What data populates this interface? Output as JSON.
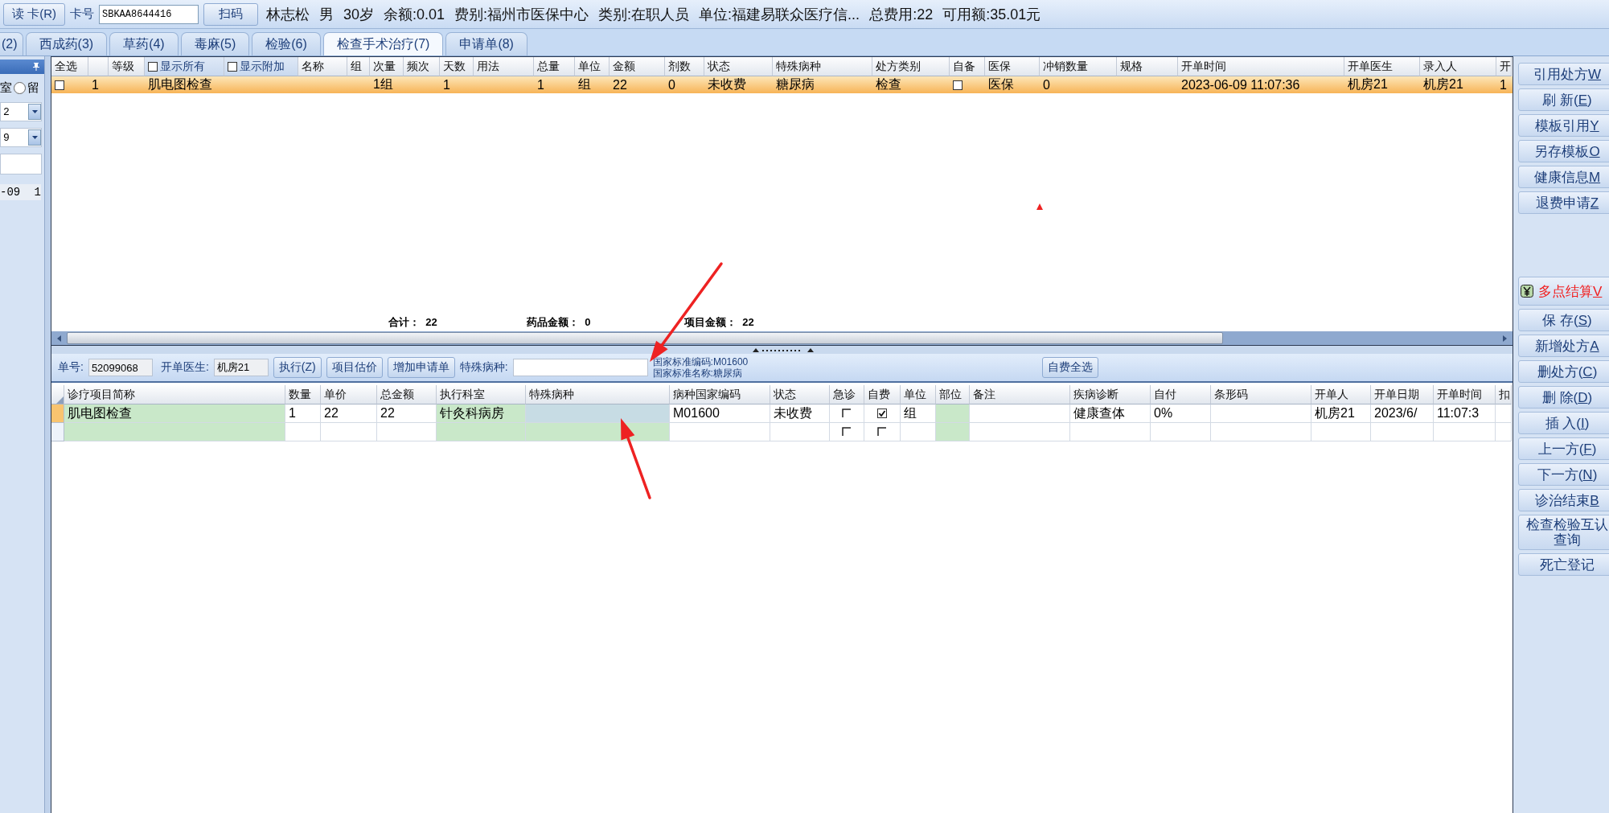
{
  "top_bar": {
    "read_card_button": "读 卡(R)",
    "card_label": "卡号",
    "card_number": "SBKAA8644416",
    "scan_button": "扫码",
    "patient_info": [
      "林志松",
      "男",
      "30岁",
      "余额:0.01",
      "费别:福州市医保中心",
      "类别:在职人员",
      "单位:福建易联众医疗信...",
      "总费用:22",
      "可用额:35.01元"
    ]
  },
  "tabs": [
    {
      "label": "(2)",
      "selected": false
    },
    {
      "label": "西成药(3)",
      "selected": false
    },
    {
      "label": "草药(4)",
      "selected": false
    },
    {
      "label": "毒麻(5)",
      "selected": false
    },
    {
      "label": "检验(6)",
      "selected": false
    },
    {
      "label": "检查手术治疗(7)",
      "selected": true
    },
    {
      "label": "申请单(8)",
      "selected": false
    }
  ],
  "left_panel": {
    "radio_prefix": "室",
    "radio_label": "留",
    "radio_selected": false,
    "dropdowns": [
      "2",
      "9"
    ],
    "list_row": [
      "-09",
      "1"
    ]
  },
  "prescription_table": {
    "columns": [
      {
        "kind": "text",
        "label": "全选"
      },
      {
        "kind": "text"
      },
      {
        "kind": "text",
        "label": "等级"
      },
      {
        "kind": "checkbox",
        "label": "显示所有",
        "checked": false
      },
      {
        "kind": "checkbox",
        "label": "显示附加",
        "checked": false
      },
      {
        "kind": "text",
        "label": "名称"
      },
      {
        "kind": "text",
        "label": "组"
      },
      {
        "kind": "text",
        "label": "次量"
      },
      {
        "kind": "text",
        "label": "频次"
      },
      {
        "kind": "text",
        "label": "天数"
      },
      {
        "kind": "text",
        "label": "用法"
      },
      {
        "kind": "text",
        "label": "总量"
      },
      {
        "kind": "text",
        "label": "单位"
      },
      {
        "kind": "text",
        "label": "金额"
      },
      {
        "kind": "text",
        "label": "剂数"
      },
      {
        "kind": "text",
        "label": "状态"
      },
      {
        "kind": "text",
        "label": "特殊病种"
      },
      {
        "kind": "text",
        "label": "处方类别"
      },
      {
        "kind": "text",
        "label": "自备"
      },
      {
        "kind": "text",
        "label": "医保"
      },
      {
        "kind": "text",
        "label": "冲销数量"
      },
      {
        "kind": "text",
        "label": "规格"
      },
      {
        "kind": "text",
        "label": "开单时间"
      },
      {
        "kind": "text",
        "label": "开单医生"
      },
      {
        "kind": "text",
        "label": "录入人"
      },
      {
        "kind": "text",
        "label": "开"
      }
    ],
    "rows": [
      {
        "selected": true,
        "cells": [
          {
            "kind": "checkbox",
            "checked": false
          },
          "1",
          null,
          "肌电图检查",
          null,
          null,
          null,
          "1组",
          null,
          "1",
          null,
          "1",
          "组",
          "22",
          "0",
          "未收费",
          "糖尿病",
          "检查",
          {
            "kind": "checkbox",
            "checked": false
          },
          "医保",
          "0",
          null,
          "2023-06-09 11:07:36",
          "机房21",
          "机房21",
          "1"
        ]
      }
    ],
    "summary": [
      "合计：  22",
      "药品金额：  0",
      "项目金额：  22"
    ]
  },
  "order_toolbar": {
    "order_no_label": "单号:",
    "order_no": "52099068",
    "doctor_label": "开单医生:",
    "doctor": "机房21",
    "buttons": [
      "执行(Z)",
      "项目估价",
      "增加申请单"
    ],
    "special_label": "特殊病种:",
    "national_code": "国家标准编码:M01600",
    "national_name": "国家标准名称:糖尿病",
    "self_pay_all_button": "自费全选"
  },
  "item_table": {
    "columns": [
      {
        "kind": "editable",
        "label": "诊疗项目简称"
      },
      {
        "kind": "text",
        "label": "数量"
      },
      {
        "kind": "text",
        "label": "单价"
      },
      {
        "kind": "text",
        "label": "总金额"
      },
      {
        "kind": "editable",
        "label": "执行科室"
      },
      {
        "kind": "editable",
        "label": "特殊病种"
      },
      {
        "kind": "text",
        "label": "病种国家编码"
      },
      {
        "kind": "text",
        "label": "状态"
      },
      {
        "kind": "checkbox",
        "label": "急诊"
      },
      {
        "kind": "checkbox",
        "label": "自费"
      },
      {
        "kind": "text",
        "label": "单位"
      },
      {
        "kind": "editable",
        "label": "部位"
      },
      {
        "kind": "text",
        "label": "备注"
      },
      {
        "kind": "text",
        "label": "疾病诊断"
      },
      {
        "kind": "text",
        "label": "自付"
      },
      {
        "kind": "text",
        "label": "条形码"
      },
      {
        "kind": "text",
        "label": "开单人"
      },
      {
        "kind": "text",
        "label": "开单日期"
      },
      {
        "kind": "text",
        "label": "开单时间"
      },
      {
        "kind": "text",
        "label": "扣"
      }
    ],
    "rows": [
      {
        "selected": true,
        "cells": [
          "肌电图检查",
          "1",
          "22",
          "22",
          "针灸科病房",
          {
            "kind": "current"
          },
          "M01600",
          "未收费",
          {
            "kind": "checkbox",
            "checked": false
          },
          {
            "kind": "checkbox",
            "checked": true
          },
          "组",
          null,
          null,
          "健康查体",
          "0%",
          null,
          "机房21",
          "2023/6/",
          "11:07:3",
          null
        ]
      },
      {
        "selected": false,
        "cells": [
          null,
          null,
          null,
          null,
          null,
          null,
          null,
          null,
          {
            "kind": "checkbox",
            "checked": false
          },
          {
            "kind": "checkbox",
            "checked": false
          },
          null,
          null,
          null,
          null,
          null,
          null,
          null,
          null,
          null,
          null
        ]
      }
    ]
  },
  "side_buttons": [
    {
      "kind": "normal",
      "label": "引用处方",
      "hotkey": "W"
    },
    {
      "kind": "normal",
      "label": "刷 新(",
      "hotkey": "E",
      "suffix": ")"
    },
    {
      "kind": "normal",
      "label": "模板引用",
      "hotkey": "Y"
    },
    {
      "kind": "normal",
      "label": "另存模板",
      "hotkey": "O"
    },
    {
      "kind": "normal",
      "label": "健康信息",
      "hotkey": "M"
    },
    {
      "kind": "normal",
      "label": "退费申请",
      "hotkey": "Z"
    },
    {
      "kind": "highlight",
      "label": "多点结算",
      "hotkey": "V"
    },
    {
      "kind": "normal",
      "label": "保  存(",
      "hotkey": "S",
      "suffix": ")"
    },
    {
      "kind": "normal",
      "label": "新增处方",
      "hotkey": "A"
    },
    {
      "kind": "normal",
      "label": "删处方(",
      "hotkey": "C",
      "suffix": ")"
    },
    {
      "kind": "normal",
      "label": "删  除(",
      "hotkey": "D",
      "suffix": ")"
    },
    {
      "kind": "normal",
      "label": "插  入(",
      "hotkey": "I",
      "suffix": ")"
    },
    {
      "kind": "normal",
      "label": "上一方(",
      "hotkey": "F",
      "suffix": ")"
    },
    {
      "kind": "normal",
      "label": "下一方(",
      "hotkey": "N",
      "suffix": ")"
    },
    {
      "kind": "normal",
      "label": "诊治结束",
      "hotkey": "B"
    },
    {
      "kind": "normal",
      "label": "检查检验互认查询"
    },
    {
      "kind": "normal",
      "label": "死亡登记"
    }
  ]
}
